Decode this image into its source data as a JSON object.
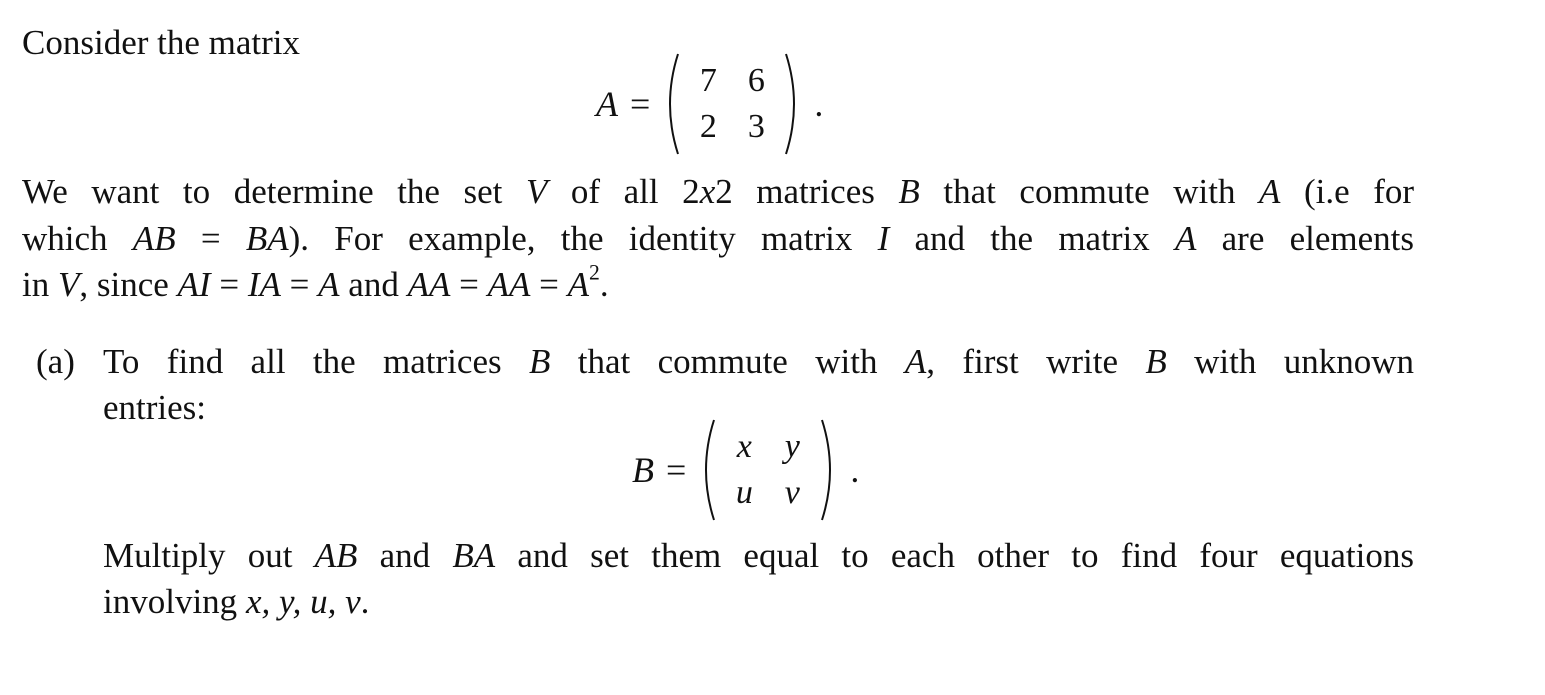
{
  "intro": {
    "text": "Consider the matrix"
  },
  "matrix_A": {
    "name": "A",
    "equals": "=",
    "entries": [
      [
        "7",
        "6"
      ],
      [
        "2",
        "3"
      ]
    ],
    "end": "."
  },
  "paragraph": {
    "line1": {
      "t1": "We want to determine the set ",
      "V": "V",
      "t2": " of all 2",
      "x": "x",
      "t3": "2 matrices ",
      "B": "B",
      "t4": " that commute with ",
      "A": "A",
      "t5": " (i.e for"
    },
    "line2": {
      "t1": "which ",
      "AB": "AB",
      "eq": " = ",
      "BA": "BA",
      "t2": "). For example, the identity matrix ",
      "I": "I",
      "t3": " and the matrix ",
      "A": "A",
      "t4": " are elements"
    },
    "line3": {
      "t1": "in ",
      "V": "V",
      "t2": ", since ",
      "AI": "AI",
      "eq1": " = ",
      "IA": "IA",
      "eq2": " = ",
      "A": "A",
      "t3": " and ",
      "AA1": "AA",
      "eq3": " = ",
      "AA2": "AA",
      "eq4": " = ",
      "A2": "A",
      "exp": "2",
      "end": "."
    }
  },
  "part_a": {
    "label": "(a)",
    "line1": {
      "t1": "To find all the matrices ",
      "B": "B",
      "t2": " that commute with ",
      "A": "A",
      "t3": ", first write ",
      "B2": "B",
      "t4": " with unknown"
    },
    "line2": "entries:",
    "matrix_B": {
      "name": "B",
      "equals": "=",
      "entries": [
        [
          "x",
          "y"
        ],
        [
          "u",
          "v"
        ]
      ],
      "end": "."
    },
    "instruction": {
      "line1": {
        "t1": "Multiply out ",
        "AB": "AB",
        "t2": " and ",
        "BA": "BA",
        "t3": " and set them equal to each other to find four equations"
      },
      "line2": {
        "t1": "involving ",
        "vars": "x, y, u, v",
        "end": "."
      }
    }
  }
}
